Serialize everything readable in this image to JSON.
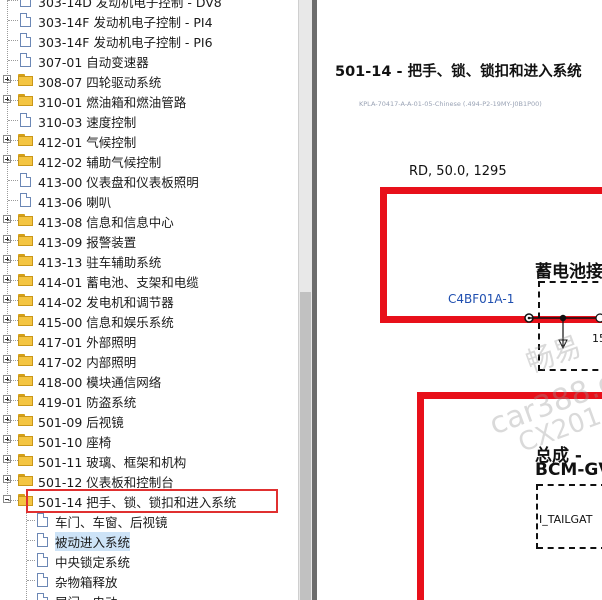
{
  "tree": {
    "items": [
      {
        "label": "303-14D 发动机电子控制 - DV8",
        "icon": "doc-icon",
        "expander": false
      },
      {
        "label": "303-14F 发动机电子控制 - PI4",
        "icon": "doc-icon",
        "expander": false
      },
      {
        "label": "303-14F 发动机电子控制 - PI6",
        "icon": "doc-icon",
        "expander": false
      },
      {
        "label": "307-01 自动变速器",
        "icon": "doc-icon",
        "expander": false
      },
      {
        "label": "308-07 四轮驱动系统",
        "icon": "folder-icon",
        "expander": true
      },
      {
        "label": "310-01 燃油箱和燃油管路",
        "icon": "folder-icon",
        "expander": true
      },
      {
        "label": "310-03 速度控制",
        "icon": "doc-icon",
        "expander": false
      },
      {
        "label": "412-01 气候控制",
        "icon": "folder-icon",
        "expander": true
      },
      {
        "label": "412-02 辅助气候控制",
        "icon": "folder-icon",
        "expander": true
      },
      {
        "label": "413-00 仪表盘和仪表板照明",
        "icon": "doc-icon",
        "expander": false
      },
      {
        "label": "413-06 喇叭",
        "icon": "doc-icon",
        "expander": false
      },
      {
        "label": "413-08 信息和信息中心",
        "icon": "folder-icon",
        "expander": true
      },
      {
        "label": "413-09 报警装置",
        "icon": "folder-icon",
        "expander": true
      },
      {
        "label": "413-13 驻车辅助系统",
        "icon": "folder-icon",
        "expander": true
      },
      {
        "label": "414-01 蓄电池、支架和电缆",
        "icon": "folder-icon",
        "expander": true
      },
      {
        "label": "414-02 发电机和调节器",
        "icon": "folder-icon",
        "expander": true
      },
      {
        "label": "415-00 信息和娱乐系统",
        "icon": "folder-icon",
        "expander": true
      },
      {
        "label": "417-01 外部照明",
        "icon": "folder-icon",
        "expander": true
      },
      {
        "label": "417-02 内部照明",
        "icon": "folder-icon",
        "expander": true
      },
      {
        "label": "418-00 模块通信网络",
        "icon": "folder-icon",
        "expander": true
      },
      {
        "label": "419-01 防盗系统",
        "icon": "folder-icon",
        "expander": true
      },
      {
        "label": "501-09 后视镜",
        "icon": "folder-icon",
        "expander": true
      },
      {
        "label": "501-10 座椅",
        "icon": "folder-icon",
        "expander": true
      },
      {
        "label": "501-11 玻璃、框架和机构",
        "icon": "folder-icon",
        "expander": true
      },
      {
        "label": "501-12 仪表板和控制台",
        "icon": "folder-icon",
        "expander": true
      },
      {
        "label": "501-14 把手、锁、锁扣和进入系统",
        "icon": "open-folder-icon",
        "expander": true,
        "expanded": true
      }
    ],
    "children": [
      {
        "label": "车门、车窗、后视镜"
      },
      {
        "label": "被动进入系统",
        "selected": true
      },
      {
        "label": "中央锁定系统"
      },
      {
        "label": "杂物箱释放"
      },
      {
        "label": "尾门 - 电动"
      }
    ]
  },
  "document": {
    "title": "501-14 - 把手、锁、锁扣和进入系统",
    "doc_id": "KPLA-70417-A-A-01-05-Chinese (.494-P2-19MY-J0B1P00)",
    "wire_label": "RD, 50.0, 1295",
    "connector_label": "C4BF01A-1",
    "battery_label": "蓄电池接",
    "assembly_label": "总成 -",
    "bcm_label": "BCM-GV",
    "signal_label": "I_TAILGAT",
    "pin_partial": "15",
    "watermark_top": "畅易",
    "watermark_mid": "car388.c",
    "watermark_bot": "CX201"
  },
  "colors": {
    "highlight_box": "#e03030",
    "diagram_red": "#e8101a",
    "connector_text": "#1f4fb0"
  }
}
